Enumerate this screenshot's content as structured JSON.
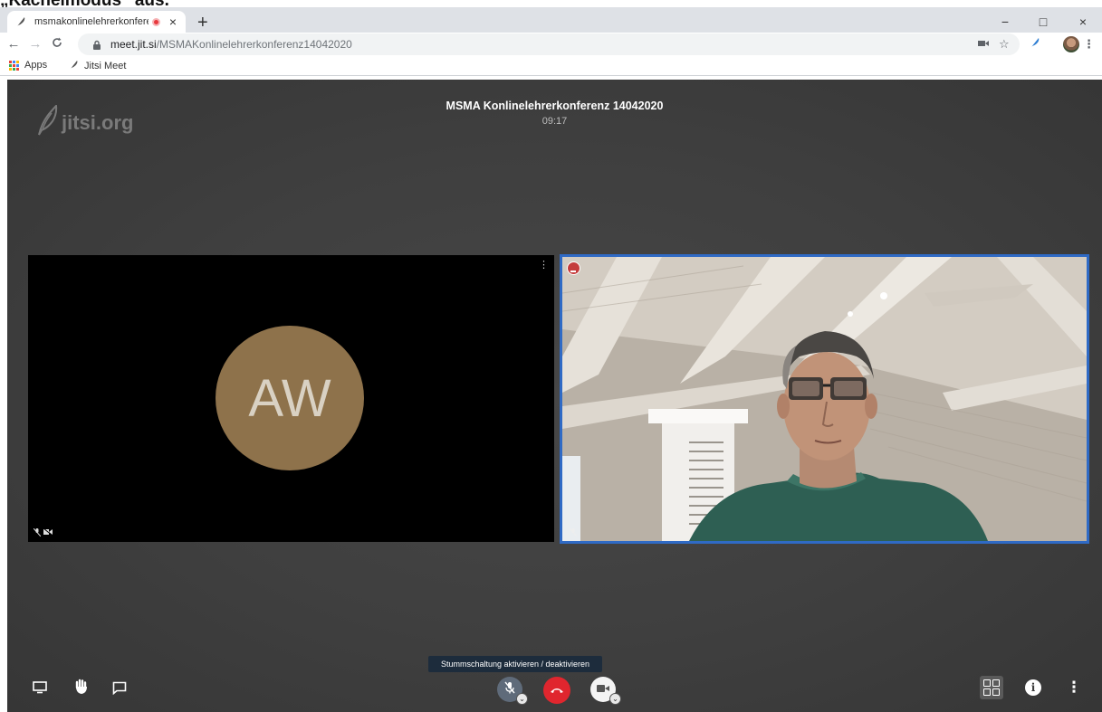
{
  "caption": "„Kachelmodus“ aus.",
  "browser": {
    "tab_title": "msmakonlinelehrerkonferenz",
    "tab_close": "×",
    "new_tab": "+",
    "window_controls": {
      "minimize": "−",
      "maximize": "□",
      "close": "×"
    },
    "url_host": "meet.jit.si",
    "url_path": "/MSMAKonlinelehrerkonferenz14042020",
    "bookmarks": [
      {
        "label": "Apps",
        "icon": "apps-grid-icon"
      },
      {
        "label": "Jitsi Meet",
        "icon": "jitsi-feather-icon"
      }
    ]
  },
  "meeting": {
    "logo_text": "jitsi.org",
    "title": "MSMA Konlinelehrerkonferenz 14042020",
    "elapsed": "09:17",
    "participants": [
      {
        "initials": "AW",
        "avatar_color": "#8e724b",
        "video": "off"
      },
      {
        "video": "on",
        "active_speaker": true
      }
    ],
    "tooltip": "Stummschaltung aktivieren / deaktivieren",
    "controls": {
      "left": [
        "screenshare-icon",
        "raise-hand-icon",
        "chat-icon"
      ],
      "center": [
        "microphone-muted-icon",
        "hangup-icon",
        "camera-icon"
      ],
      "right": [
        "tile-view-icon",
        "info-icon",
        "more-options-icon"
      ]
    },
    "colors": {
      "hangup": "#e0262e",
      "active_border": "#2f6ac5",
      "mic_muted_bg": "#5f6b7a"
    }
  }
}
